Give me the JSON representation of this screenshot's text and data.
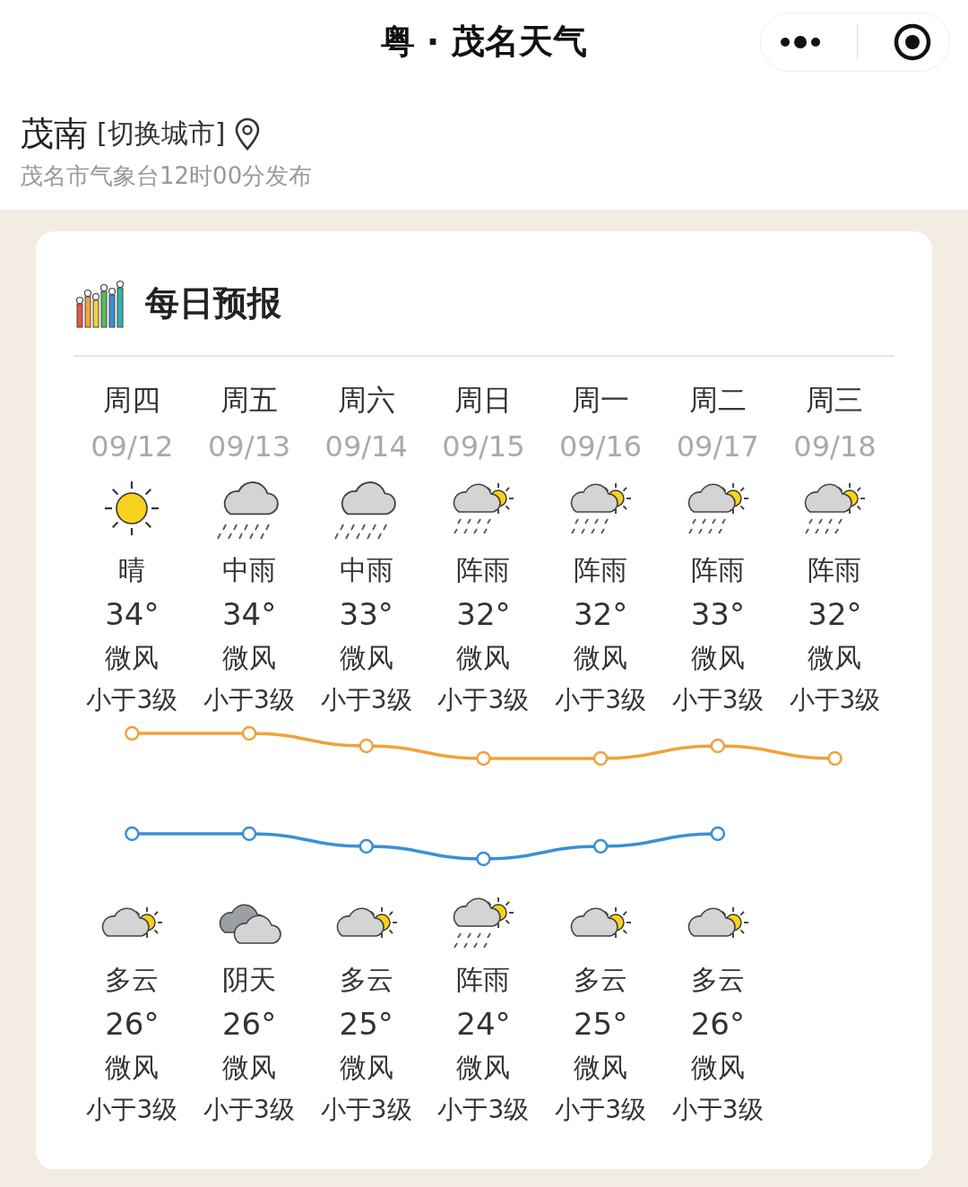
{
  "header": {
    "title": "粤 · 茂名天气"
  },
  "location": {
    "city": "茂南",
    "switch_link": "[切换城市]",
    "publisher": "茂名市气象台12时00分发布"
  },
  "forecast": {
    "title": "每日预报",
    "days": [
      {
        "day": "周四",
        "date": "09/12",
        "kind": "sun",
        "condition": "晴",
        "temp": "34°",
        "wind": "微风",
        "wind_level": "小于3级"
      },
      {
        "day": "周五",
        "date": "09/13",
        "kind": "rain_cloud",
        "condition": "中雨",
        "temp": "34°",
        "wind": "微风",
        "wind_level": "小于3级"
      },
      {
        "day": "周六",
        "date": "09/14",
        "kind": "rain_cloud",
        "condition": "中雨",
        "temp": "33°",
        "wind": "微风",
        "wind_level": "小于3级"
      },
      {
        "day": "周日",
        "date": "09/15",
        "kind": "partly_rain",
        "condition": "阵雨",
        "temp": "32°",
        "wind": "微风",
        "wind_level": "小于3级"
      },
      {
        "day": "周一",
        "date": "09/16",
        "kind": "partly_rain",
        "condition": "阵雨",
        "temp": "32°",
        "wind": "微风",
        "wind_level": "小于3级"
      },
      {
        "day": "周二",
        "date": "09/17",
        "kind": "partly_rain",
        "condition": "阵雨",
        "temp": "33°",
        "wind": "微风",
        "wind_level": "小于3级"
      },
      {
        "day": "周三",
        "date": "09/18",
        "kind": "partly_rain",
        "condition": "阵雨",
        "temp": "32°",
        "wind": "微风",
        "wind_level": "小于3级"
      }
    ],
    "nights": [
      {
        "kind": "partly_cloudy",
        "condition": "多云",
        "temp": "26°",
        "wind": "微风",
        "wind_level": "小于3级"
      },
      {
        "kind": "overcast",
        "condition": "阴天",
        "temp": "26°",
        "wind": "微风",
        "wind_level": "小于3级"
      },
      {
        "kind": "partly_cloudy",
        "condition": "多云",
        "temp": "25°",
        "wind": "微风",
        "wind_level": "小于3级"
      },
      {
        "kind": "partly_rain",
        "condition": "阵雨",
        "temp": "24°",
        "wind": "微风",
        "wind_level": "小于3级"
      },
      {
        "kind": "partly_cloudy",
        "condition": "多云",
        "temp": "25°",
        "wind": "微风",
        "wind_level": "小于3级"
      },
      {
        "kind": "partly_cloudy",
        "condition": "多云",
        "temp": "26°",
        "wind": "微风",
        "wind_level": "小于3级"
      }
    ]
  }
}
